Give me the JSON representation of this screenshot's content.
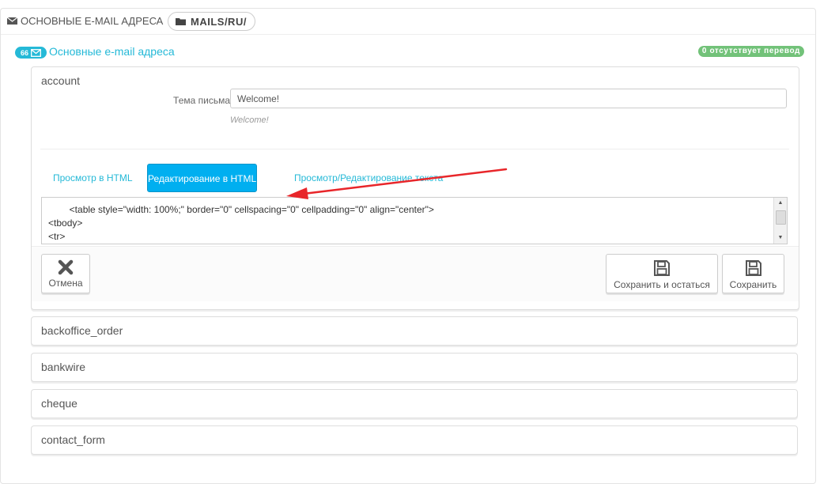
{
  "header": {
    "title": "Основные e-mail адреса",
    "path": "MAILS/RU/"
  },
  "section": {
    "count": "66",
    "title": "Основные e-mail адреса",
    "missing_translation": "0 отсутствует перевод"
  },
  "account": {
    "title": "account",
    "subject_label": "Тема письма",
    "subject_value": "Welcome!",
    "subject_hint": "Welcome!",
    "tabs": [
      {
        "label": "Просмотр в HTML",
        "active": false
      },
      {
        "label": "Редактирование в HTML",
        "active": true
      },
      {
        "label": "Просмотр/Редактирование текста",
        "active": false
      }
    ],
    "code_lines": [
      "        <table style=\"width: 100%;\" border=\"0\" cellspacing=\"0\" cellpadding=\"0\" align=\"center\">",
      "<tbody>",
      "<tr>"
    ]
  },
  "footer": {
    "cancel_label": "Отмена",
    "save_stay_label": "Сохранить и остаться",
    "save_label": "Сохранить"
  },
  "templates": [
    "backoffice_order",
    "bankwire",
    "cheque",
    "contact_form"
  ],
  "colors": {
    "accent": "#25b9d7",
    "active_tab": "#00aff0",
    "success_badge": "#72c279",
    "annotation_arrow": "#e8262a"
  },
  "icons": {
    "header": "envelope-icon",
    "path": "folder-icon",
    "count": "envelope-outline-icon",
    "cancel": "close-icon",
    "save": "floppy-disk-icon"
  }
}
